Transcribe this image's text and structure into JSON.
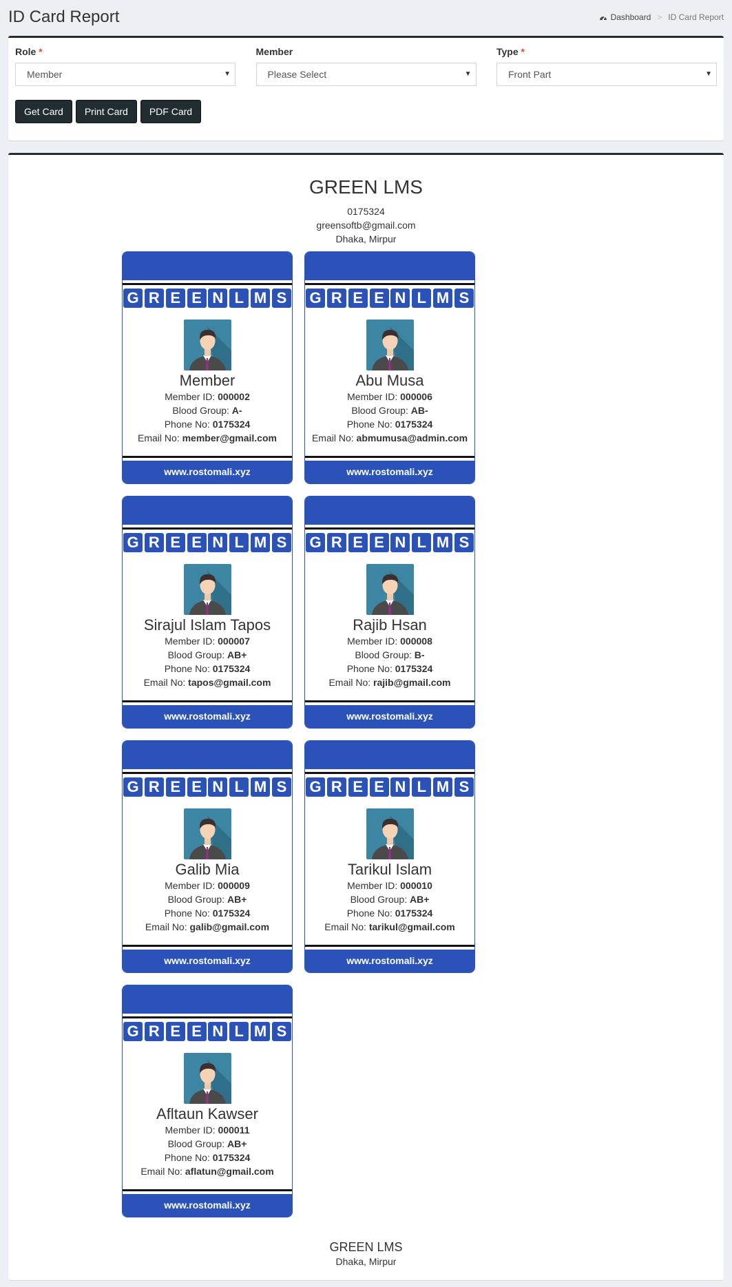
{
  "header": {
    "title": "ID Card Report",
    "breadcrumb": {
      "home": "Dashboard",
      "current": "ID Card Report"
    }
  },
  "filters": {
    "role": {
      "label": "Role",
      "required_mark": "*",
      "value": "Member"
    },
    "member": {
      "label": "Member",
      "value": "Please Select"
    },
    "type": {
      "label": "Type",
      "required_mark": "*",
      "value": "Front Part"
    },
    "buttons": {
      "get_card": "Get Card",
      "print_card": "Print Card",
      "pdf_card": "PDF Card"
    }
  },
  "report": {
    "org_name": "GREEN LMS",
    "phone": "0175324",
    "email": "greensoftb@gmail.com",
    "address": "Dhaka, Mirpur",
    "footer_name": "GREEN LMS",
    "footer_address": "Dhaka, Mirpur"
  },
  "card_template": {
    "letters": [
      "G",
      "R",
      "E",
      "E",
      "N",
      "L",
      "M",
      "S"
    ],
    "labels": {
      "member_id": "Member ID:",
      "blood_group": "Blood Group:",
      "phone": "Phone No:",
      "email": "Email No:"
    },
    "website": "www.rostomali.xyz"
  },
  "cards": [
    {
      "name": "Member",
      "member_id": "000002",
      "blood_group": "A-",
      "phone": "0175324",
      "email": "member@gmail.com"
    },
    {
      "name": "Abu Musa",
      "member_id": "000006",
      "blood_group": "AB-",
      "phone": "0175324",
      "email": "abmumusa@admin.com"
    },
    {
      "name": "Sirajul Islam Tapos",
      "member_id": "000007",
      "blood_group": "AB+",
      "phone": "0175324",
      "email": "tapos@gmail.com"
    },
    {
      "name": "Rajib Hsan",
      "member_id": "000008",
      "blood_group": "B-",
      "phone": "0175324",
      "email": "rajib@gmail.com"
    },
    {
      "name": "Galib Mia",
      "member_id": "000009",
      "blood_group": "AB+",
      "phone": "0175324",
      "email": "galib@gmail.com"
    },
    {
      "name": "Tarikul Islam",
      "member_id": "000010",
      "blood_group": "AB+",
      "phone": "0175324",
      "email": "tarikul@gmail.com"
    },
    {
      "name": "Afltaun Kawser",
      "member_id": "000011",
      "blood_group": "AB+",
      "phone": "0175324",
      "email": "aflatun@gmail.com"
    }
  ],
  "colors": {
    "card_blue": "#2a52b8",
    "dark": "#222d32",
    "background": "#ecf0f5"
  },
  "icons": {
    "breadcrumb_home": "dashboard-icon",
    "select_caret": "caret-down-icon",
    "photo": "user-avatar"
  }
}
